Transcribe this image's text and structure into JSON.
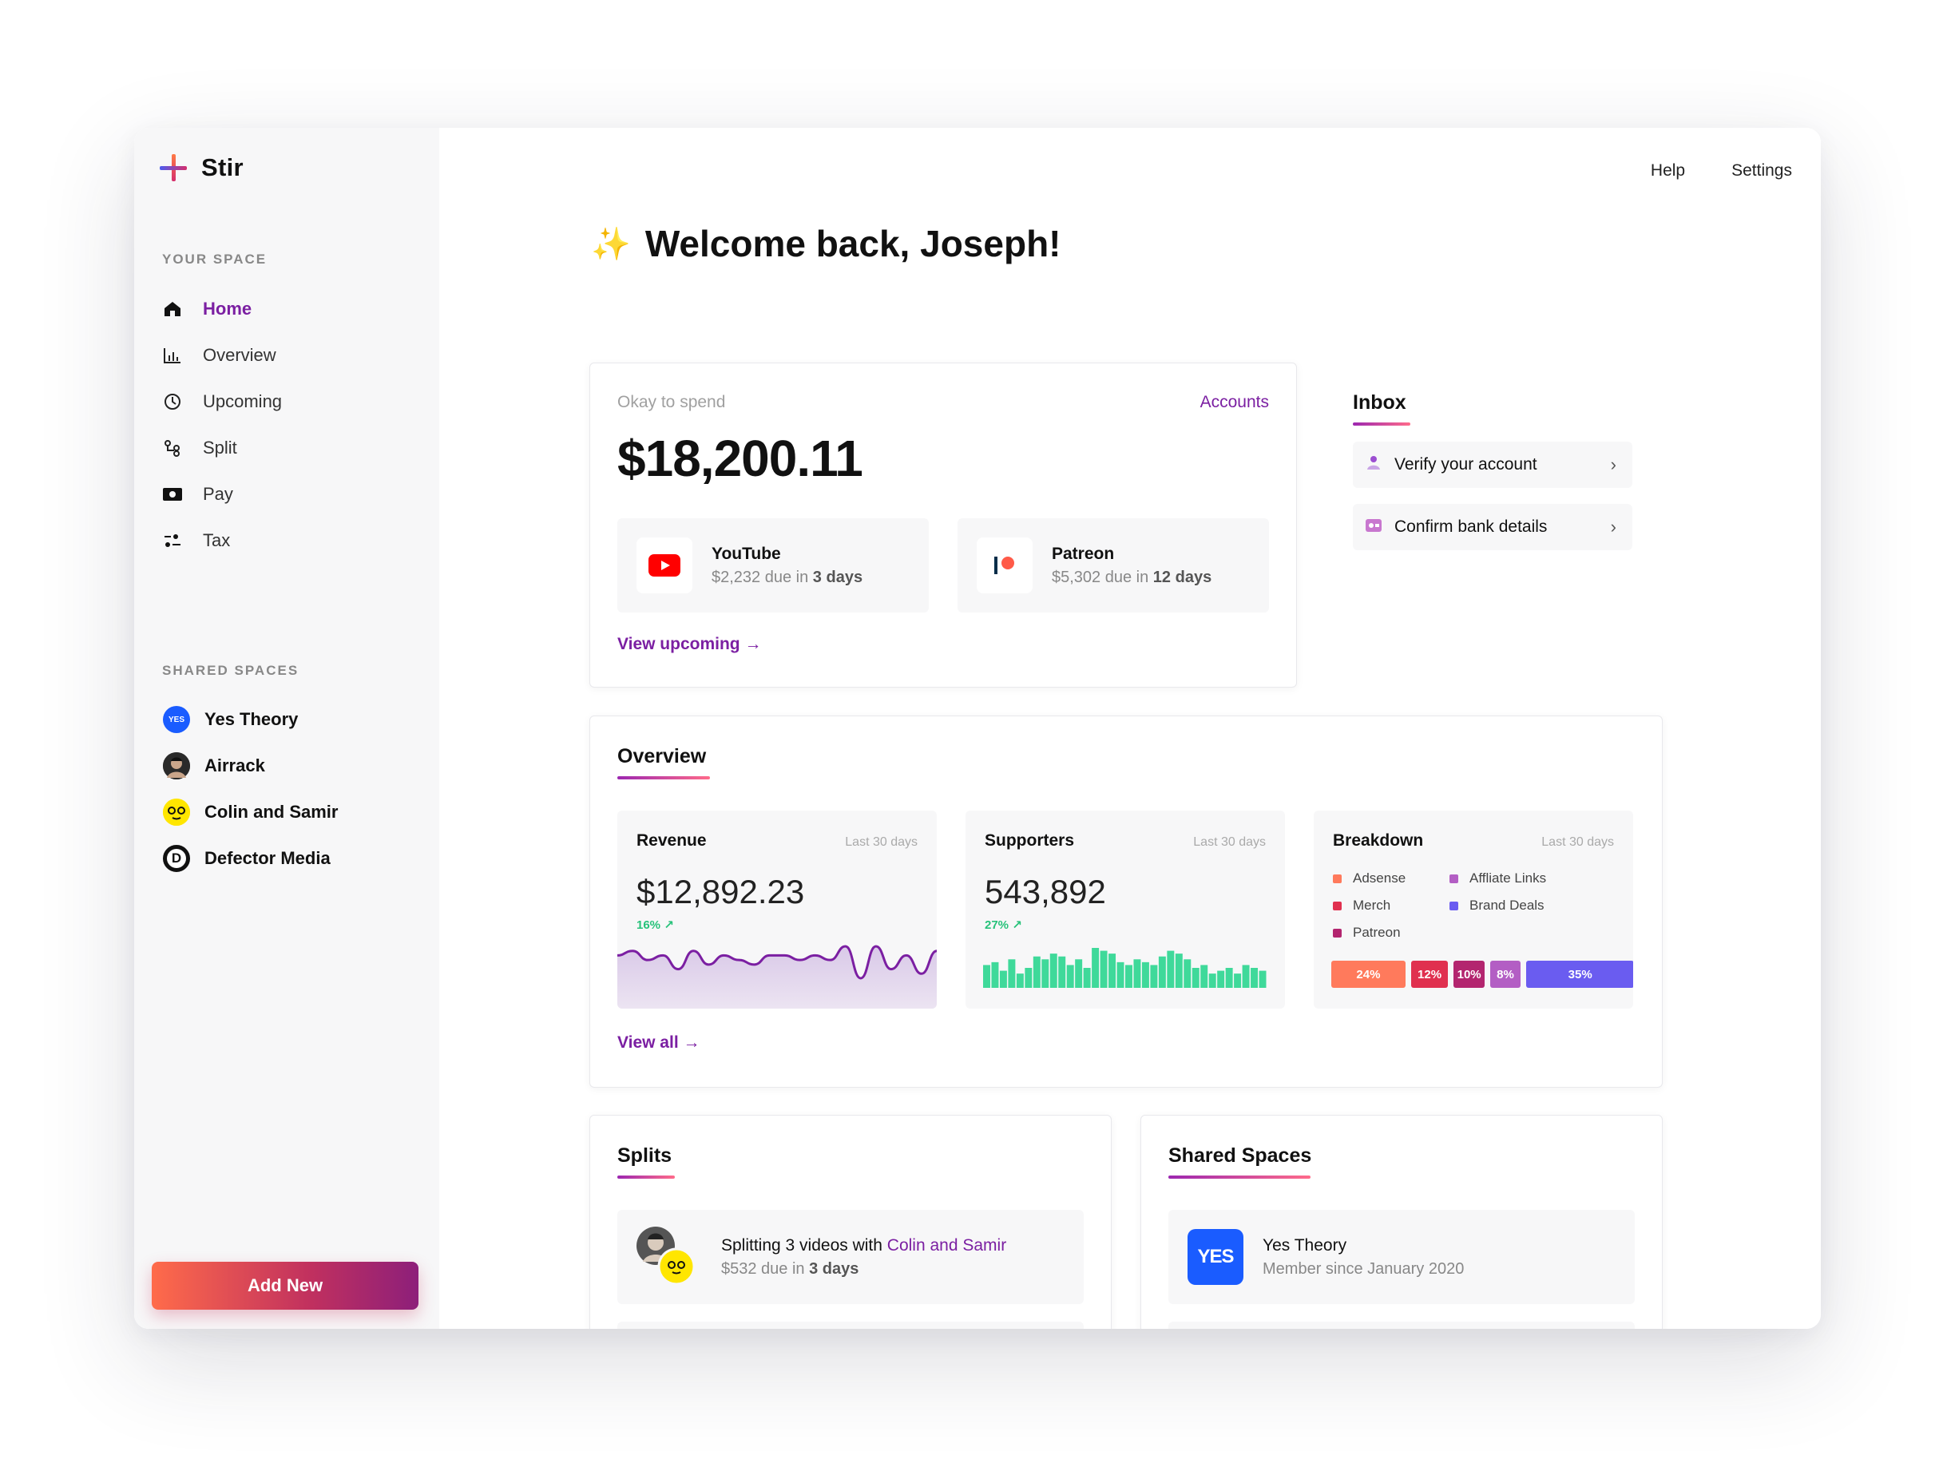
{
  "app": {
    "name": "Stir"
  },
  "topnav": {
    "help": "Help",
    "settings": "Settings"
  },
  "welcome": "Welcome back, Joseph!",
  "sidebar": {
    "your_space_label": "YOUR SPACE",
    "items": [
      {
        "label": "Home",
        "icon": "home-icon",
        "active": true
      },
      {
        "label": "Overview",
        "icon": "bar-chart-icon"
      },
      {
        "label": "Upcoming",
        "icon": "clock-icon"
      },
      {
        "label": "Split",
        "icon": "split-icon"
      },
      {
        "label": "Pay",
        "icon": "cash-icon"
      },
      {
        "label": "Tax",
        "icon": "tax-icon"
      }
    ],
    "shared_spaces_label": "SHARED SPACES",
    "spaces": [
      {
        "label": "Yes Theory",
        "avatar_text": "YES"
      },
      {
        "label": "Airrack"
      },
      {
        "label": "Colin and Samir"
      },
      {
        "label": "Defector Media",
        "avatar_text": "D"
      }
    ],
    "add_new": "Add New"
  },
  "spend": {
    "label": "Okay to spend",
    "accounts_link": "Accounts",
    "amount": "$18,200.11",
    "payouts": [
      {
        "name": "YouTube",
        "amount": "$2,232 due in",
        "due": "3 days"
      },
      {
        "name": "Patreon",
        "amount": "$5,302 due in",
        "due": "12 days"
      }
    ],
    "view_upcoming": "View upcoming →"
  },
  "inbox": {
    "title": "Inbox",
    "items": [
      {
        "label": "Verify your account"
      },
      {
        "label": "Confirm bank details"
      }
    ]
  },
  "overview": {
    "title": "Overview",
    "revenue": {
      "title": "Revenue",
      "period": "Last 30 days",
      "value": "$12,892.23",
      "delta": "16%"
    },
    "supporters": {
      "title": "Supporters",
      "period": "Last 30 days",
      "value": "543,892",
      "delta": "27%"
    },
    "breakdown": {
      "title": "Breakdown",
      "period": "Last 30 days",
      "legend": [
        "Adsense",
        "Affliate Links",
        "Merch",
        "Brand Deals",
        "Patreon"
      ],
      "segments": [
        {
          "label": "24%",
          "value": 24,
          "color": "#ff7a5c"
        },
        {
          "label": "12%",
          "value": 12,
          "color": "#e0304f"
        },
        {
          "label": "10%",
          "value": 10,
          "color": "#b3256f"
        },
        {
          "label": "8%",
          "value": 8,
          "color": "#b35ec4"
        },
        {
          "label": "35%",
          "value": 35,
          "color": "#6a5cf0"
        }
      ]
    },
    "view_all": "View all →"
  },
  "splits": {
    "title": "Splits",
    "item": {
      "prefix": "Splitting 3 videos with",
      "partner": "Colin and Samir",
      "sub_prefix": "$532 due in",
      "sub_due": "3 days"
    }
  },
  "shared_spaces": {
    "title": "Shared Spaces",
    "item": {
      "name": "Yes Theory",
      "sub": "Member since January 2020",
      "logo_text": "YES"
    }
  },
  "colors": {
    "accent": "#7b1fa2",
    "positive": "#27c27a",
    "supporters_bars": "#3fd99a",
    "revenue_line": "#7b1fa2"
  },
  "chart_data": [
    {
      "type": "line",
      "title": "Revenue",
      "values": [
        12,
        13,
        11,
        12,
        9,
        13,
        10,
        12,
        11,
        10,
        12,
        12,
        11,
        12,
        11,
        14,
        7,
        14,
        9,
        12,
        8,
        13
      ]
    },
    {
      "type": "bar",
      "title": "Supporters",
      "values": [
        8,
        9,
        6,
        10,
        5,
        7,
        11,
        10,
        12,
        11,
        8,
        10,
        7,
        14,
        13,
        12,
        9,
        8,
        10,
        9,
        8,
        11,
        13,
        12,
        10,
        7,
        8,
        5,
        6,
        7,
        5,
        8,
        7,
        6
      ]
    }
  ]
}
